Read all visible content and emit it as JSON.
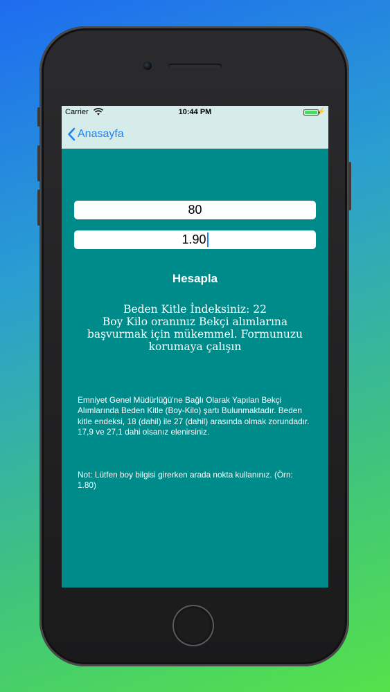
{
  "status_bar": {
    "carrier": "Carrier",
    "time": "10:44 PM",
    "wifi_icon": "wifi-icon",
    "battery_icon": "battery-icon",
    "charging_icon": "bolt-icon"
  },
  "nav": {
    "back_label": "Anasayfa",
    "back_icon": "chevron-left-icon"
  },
  "form": {
    "weight_value": "80",
    "height_value": "1.90",
    "calculate_label": "Hesapla"
  },
  "result": {
    "bmi_line": "Beden Kitle İndeksiniz: 22",
    "message": "Boy Kilo oranınız Bekçi alımlarına başvurmak için mükemmel. Formunuzu korumaya çalışın"
  },
  "info": {
    "paragraph1": "Emniyet Genel Müdürlüğü'ne Bağlı Olarak Yapılan Bekçi Alımlarında Beden Kitle (Boy-Kilo)  şartı Bulunmaktadır. Beden kitle endeksi, 18 (dahil) ile 27 (dahil) arasında olmak zorundadır. 17,9 ve 27,1 dahi olsanız elenirsiniz.",
    "paragraph2": "Not: Lütfen boy bilgisi girerken arada nokta kullanınız. (Örn: 1.80)"
  },
  "colors": {
    "screen_background": "#008b8b",
    "nav_background": "#d6eceb",
    "accent": "#1a82f7"
  }
}
